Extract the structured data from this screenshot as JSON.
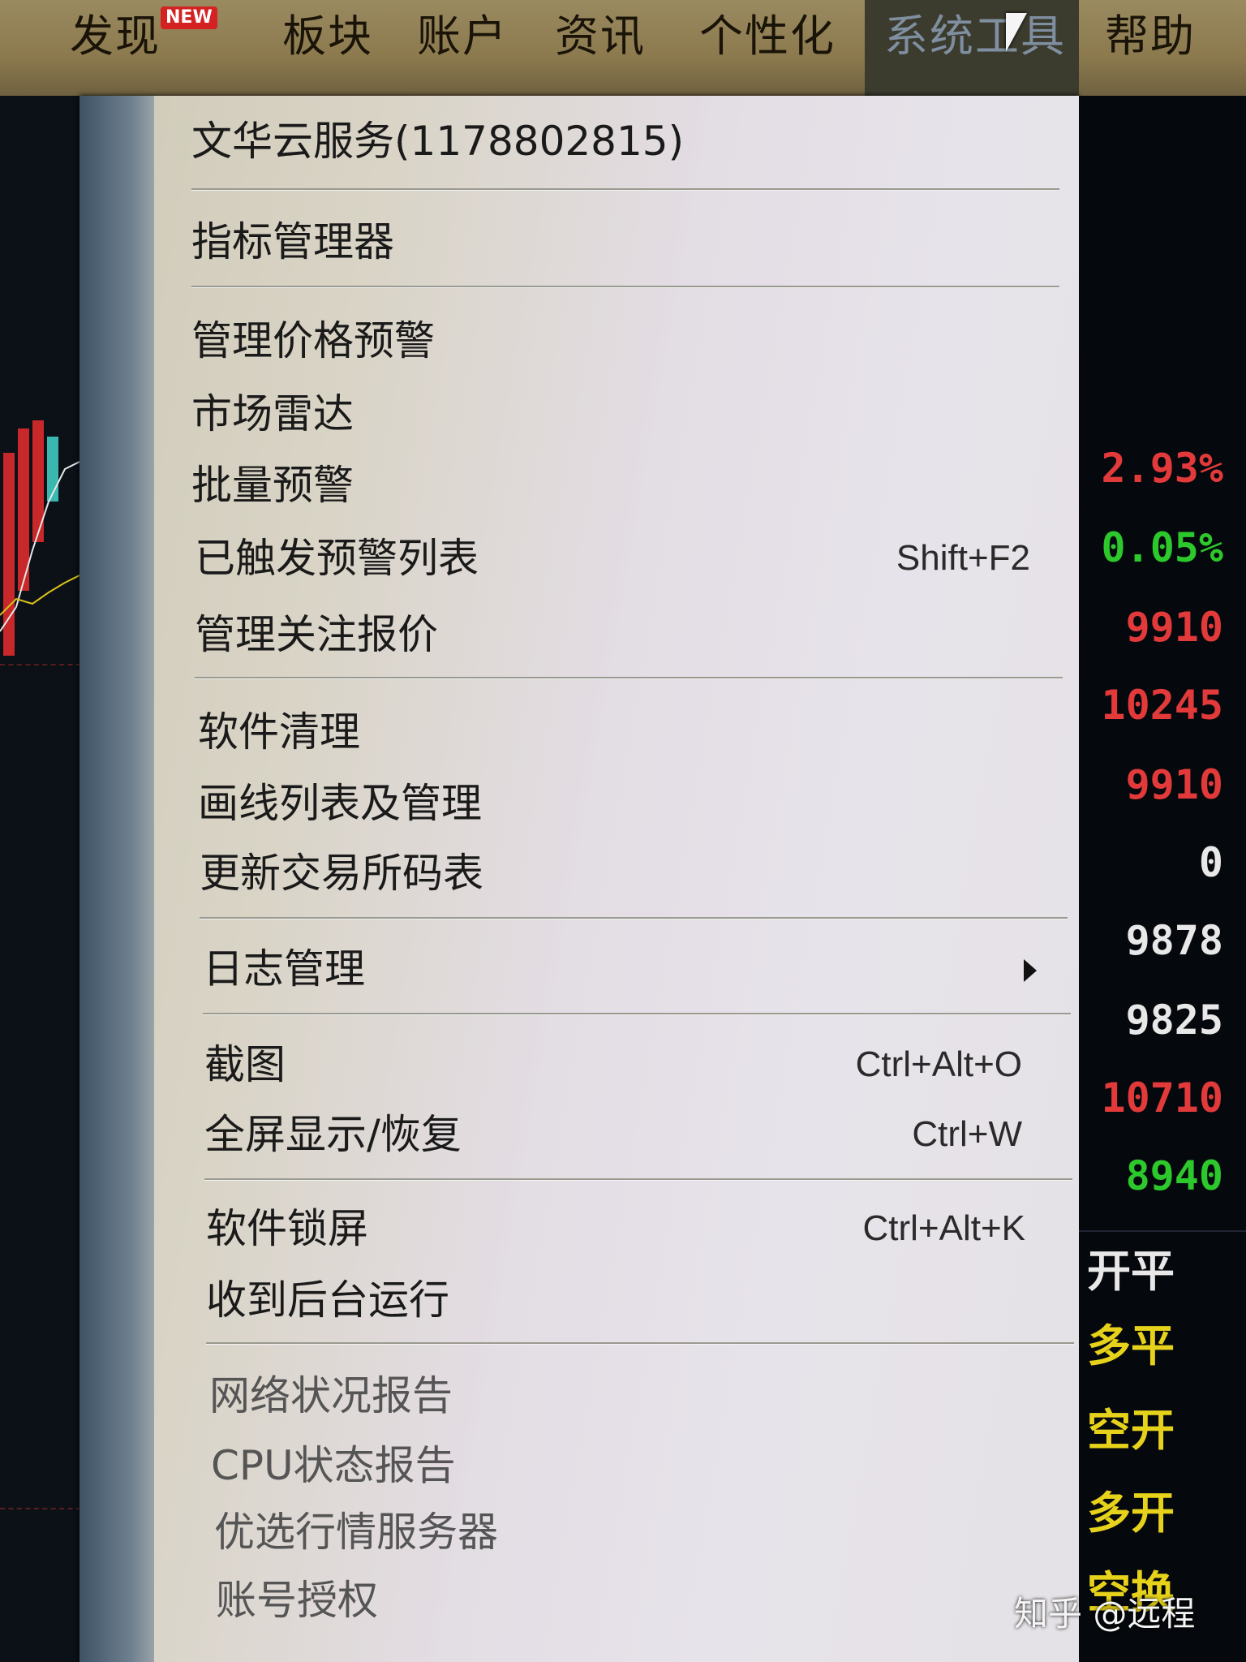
{
  "menubar": {
    "items": [
      {
        "label": "发现"
      },
      {
        "label": "板块"
      },
      {
        "label": "账户"
      },
      {
        "label": "资讯"
      },
      {
        "label": "个性化"
      },
      {
        "label": "系统工具"
      },
      {
        "label": "帮助"
      }
    ],
    "new_badge": "NEW"
  },
  "dropdown": {
    "items": [
      {
        "label": "文华云服务(1178802815)",
        "shortcut": ""
      },
      {
        "label": "指标管理器",
        "shortcut": ""
      },
      {
        "label": "管理价格预警",
        "shortcut": ""
      },
      {
        "label": "市场雷达",
        "shortcut": ""
      },
      {
        "label": "批量预警",
        "shortcut": ""
      },
      {
        "label": "已触发预警列表",
        "shortcut": "Shift+F2"
      },
      {
        "label": "管理关注报价",
        "shortcut": ""
      },
      {
        "label": "软件清理",
        "shortcut": ""
      },
      {
        "label": "画线列表及管理",
        "shortcut": ""
      },
      {
        "label": "更新交易所码表",
        "shortcut": ""
      },
      {
        "label": "日志管理",
        "shortcut": ""
      },
      {
        "label": "截图",
        "shortcut": "Ctrl+Alt+O"
      },
      {
        "label": "全屏显示/恢复",
        "shortcut": "Ctrl+W"
      },
      {
        "label": "软件锁屏",
        "shortcut": "Ctrl+Alt+K"
      },
      {
        "label": "收到后台运行",
        "shortcut": ""
      },
      {
        "label": "网络状况报告",
        "shortcut": ""
      },
      {
        "label": "CPU状态报告",
        "shortcut": ""
      },
      {
        "label": "优选行情服务器",
        "shortcut": ""
      },
      {
        "label": "账号授权",
        "shortcut": ""
      }
    ]
  },
  "right_panel": {
    "values": [
      {
        "text": "2.93%",
        "color": "#e23a3a"
      },
      {
        "text": "0.05%",
        "color": "#2cc82c"
      },
      {
        "text": "9910",
        "color": "#e23a3a"
      },
      {
        "text": "10245",
        "color": "#e23a3a"
      },
      {
        "text": "9910",
        "color": "#e23a3a"
      },
      {
        "text": "0",
        "color": "#e8e8e8"
      },
      {
        "text": "9878",
        "color": "#e8e8e8"
      },
      {
        "text": "9825",
        "color": "#e8e8e8"
      },
      {
        "text": "10710",
        "color": "#e23a3a"
      },
      {
        "text": "8940",
        "color": "#2cc82c"
      }
    ],
    "trade_types": [
      {
        "text": "开平",
        "color": "#e8e8e8"
      },
      {
        "text": "多平",
        "color": "#e6d21a"
      },
      {
        "text": "空开",
        "color": "#e6d21a"
      },
      {
        "text": "多开",
        "color": "#e6d21a"
      },
      {
        "text": "空换",
        "color": "#e6d21a"
      }
    ]
  },
  "watermark": "知乎 @远程"
}
